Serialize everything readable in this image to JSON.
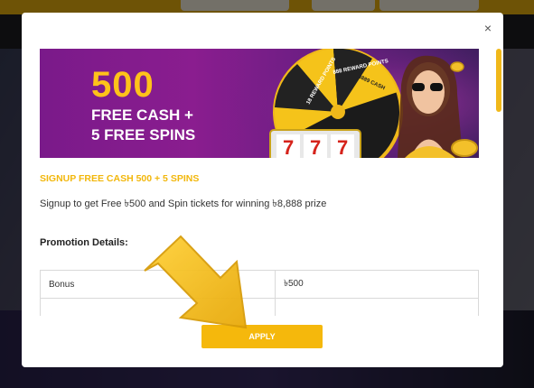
{
  "modal": {
    "close_glyph": "×",
    "banner": {
      "amount": "500",
      "line1": "FREE CASH +",
      "line2": "5 FREE SPINS",
      "wheel_labels": [
        "18 REWARD POINTS",
        "888 REWARD POINTS",
        "8889 CASH"
      ],
      "slot_digits": [
        "7",
        "7",
        "7"
      ]
    },
    "promo_title": "SIGNUP FREE CASH 500 + 5 SPINS",
    "promo_description": "Signup to get Free ৳500 and Spin tickets for winning ৳8,888 prize",
    "details_heading": "Promotion Details:",
    "details_rows": [
      {
        "label": "Bonus",
        "value": "৳500"
      },
      {
        "label": "",
        "value": ""
      }
    ],
    "apply_label": "APPLY"
  },
  "colors": {
    "accent": "#f5b80c",
    "banner_purple": "#7a1a8a",
    "overlay": "rgba(0,0,0,0.55)"
  },
  "icons": {
    "close": "close-icon",
    "pointer": "arrow-pointer-icon"
  }
}
